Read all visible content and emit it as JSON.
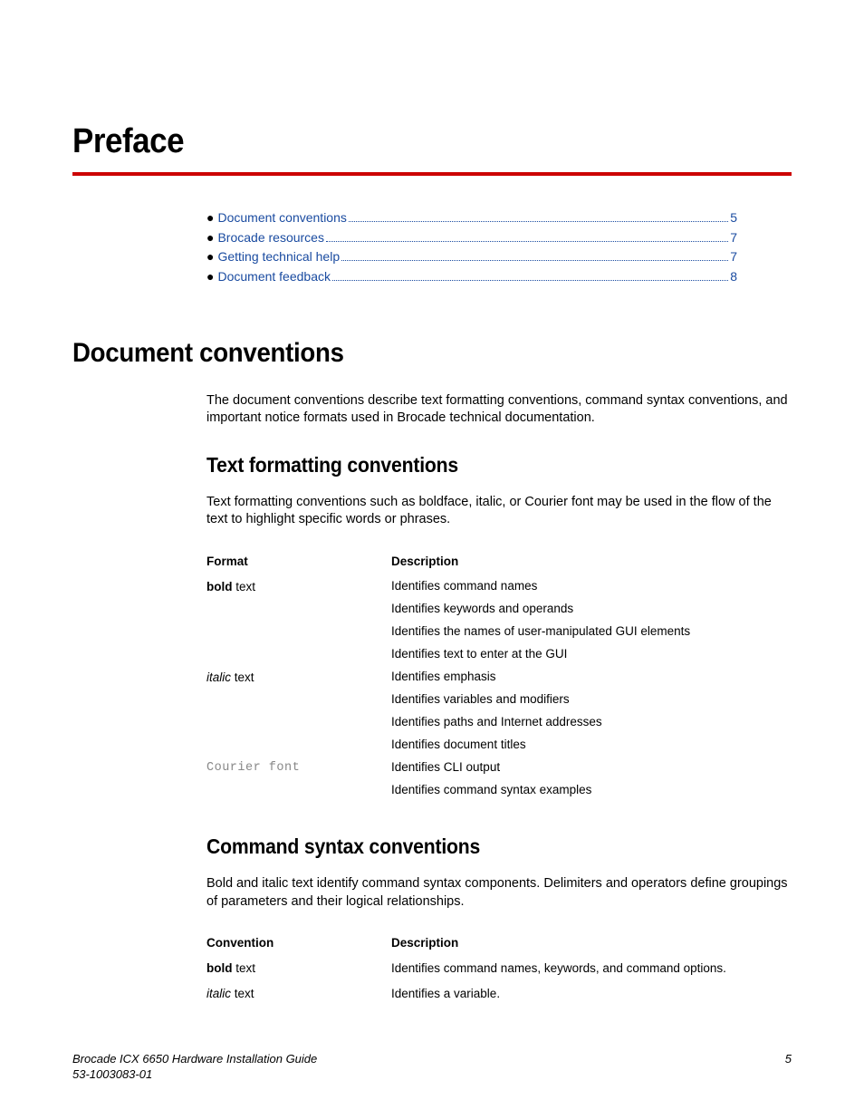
{
  "title": "Preface",
  "toc": [
    {
      "label": "Document conventions",
      "page": "5"
    },
    {
      "label": "Brocade resources",
      "page": "7"
    },
    {
      "label": "Getting technical help",
      "page": "7"
    },
    {
      "label": "Document feedback",
      "page": "8"
    }
  ],
  "section1": {
    "heading": "Document conventions",
    "body": "The document conventions describe text formatting conventions, command syntax conventions, and important notice formats used in Brocade technical documentation."
  },
  "sub1": {
    "heading": "Text formatting conventions",
    "body": "Text formatting conventions such as boldface, italic, or Courier font may be used in the flow of the text to highlight specific words or phrases.",
    "tableHead": {
      "c1": "Format",
      "c2": "Description"
    },
    "rows": [
      {
        "fmtBold": "bold",
        "fmtRest": " text",
        "lines": [
          "Identifies command names",
          "Identifies keywords and operands",
          "Identifies the names of user-manipulated GUI elements",
          "Identifies text to enter at the GUI"
        ]
      },
      {
        "fmtItalic": "italic",
        "fmtRest": " text",
        "lines": [
          "Identifies emphasis",
          "Identifies variables and modifiers",
          "Identifies paths and Internet addresses",
          "Identifies document titles"
        ]
      },
      {
        "fmtCourier": "Courier font",
        "lines": [
          "Identifies CLI output",
          "Identifies command syntax examples"
        ]
      }
    ]
  },
  "sub2": {
    "heading": "Command syntax conventions",
    "body": "Bold and italic text identify command syntax components. Delimiters and operators define groupings of parameters and their logical relationships.",
    "tableHead": {
      "c1": "Convention",
      "c2": "Description"
    },
    "rows": [
      {
        "fmtBold": "bold",
        "fmtRest": " text",
        "desc": "Identifies command names, keywords, and command options."
      },
      {
        "fmtItalic": "italic",
        "fmtRest": " text",
        "desc": "Identifies a variable."
      }
    ]
  },
  "footer": {
    "line1": "Brocade ICX 6650 Hardware Installation Guide",
    "line2": "53-1003083-01",
    "page": "5"
  }
}
